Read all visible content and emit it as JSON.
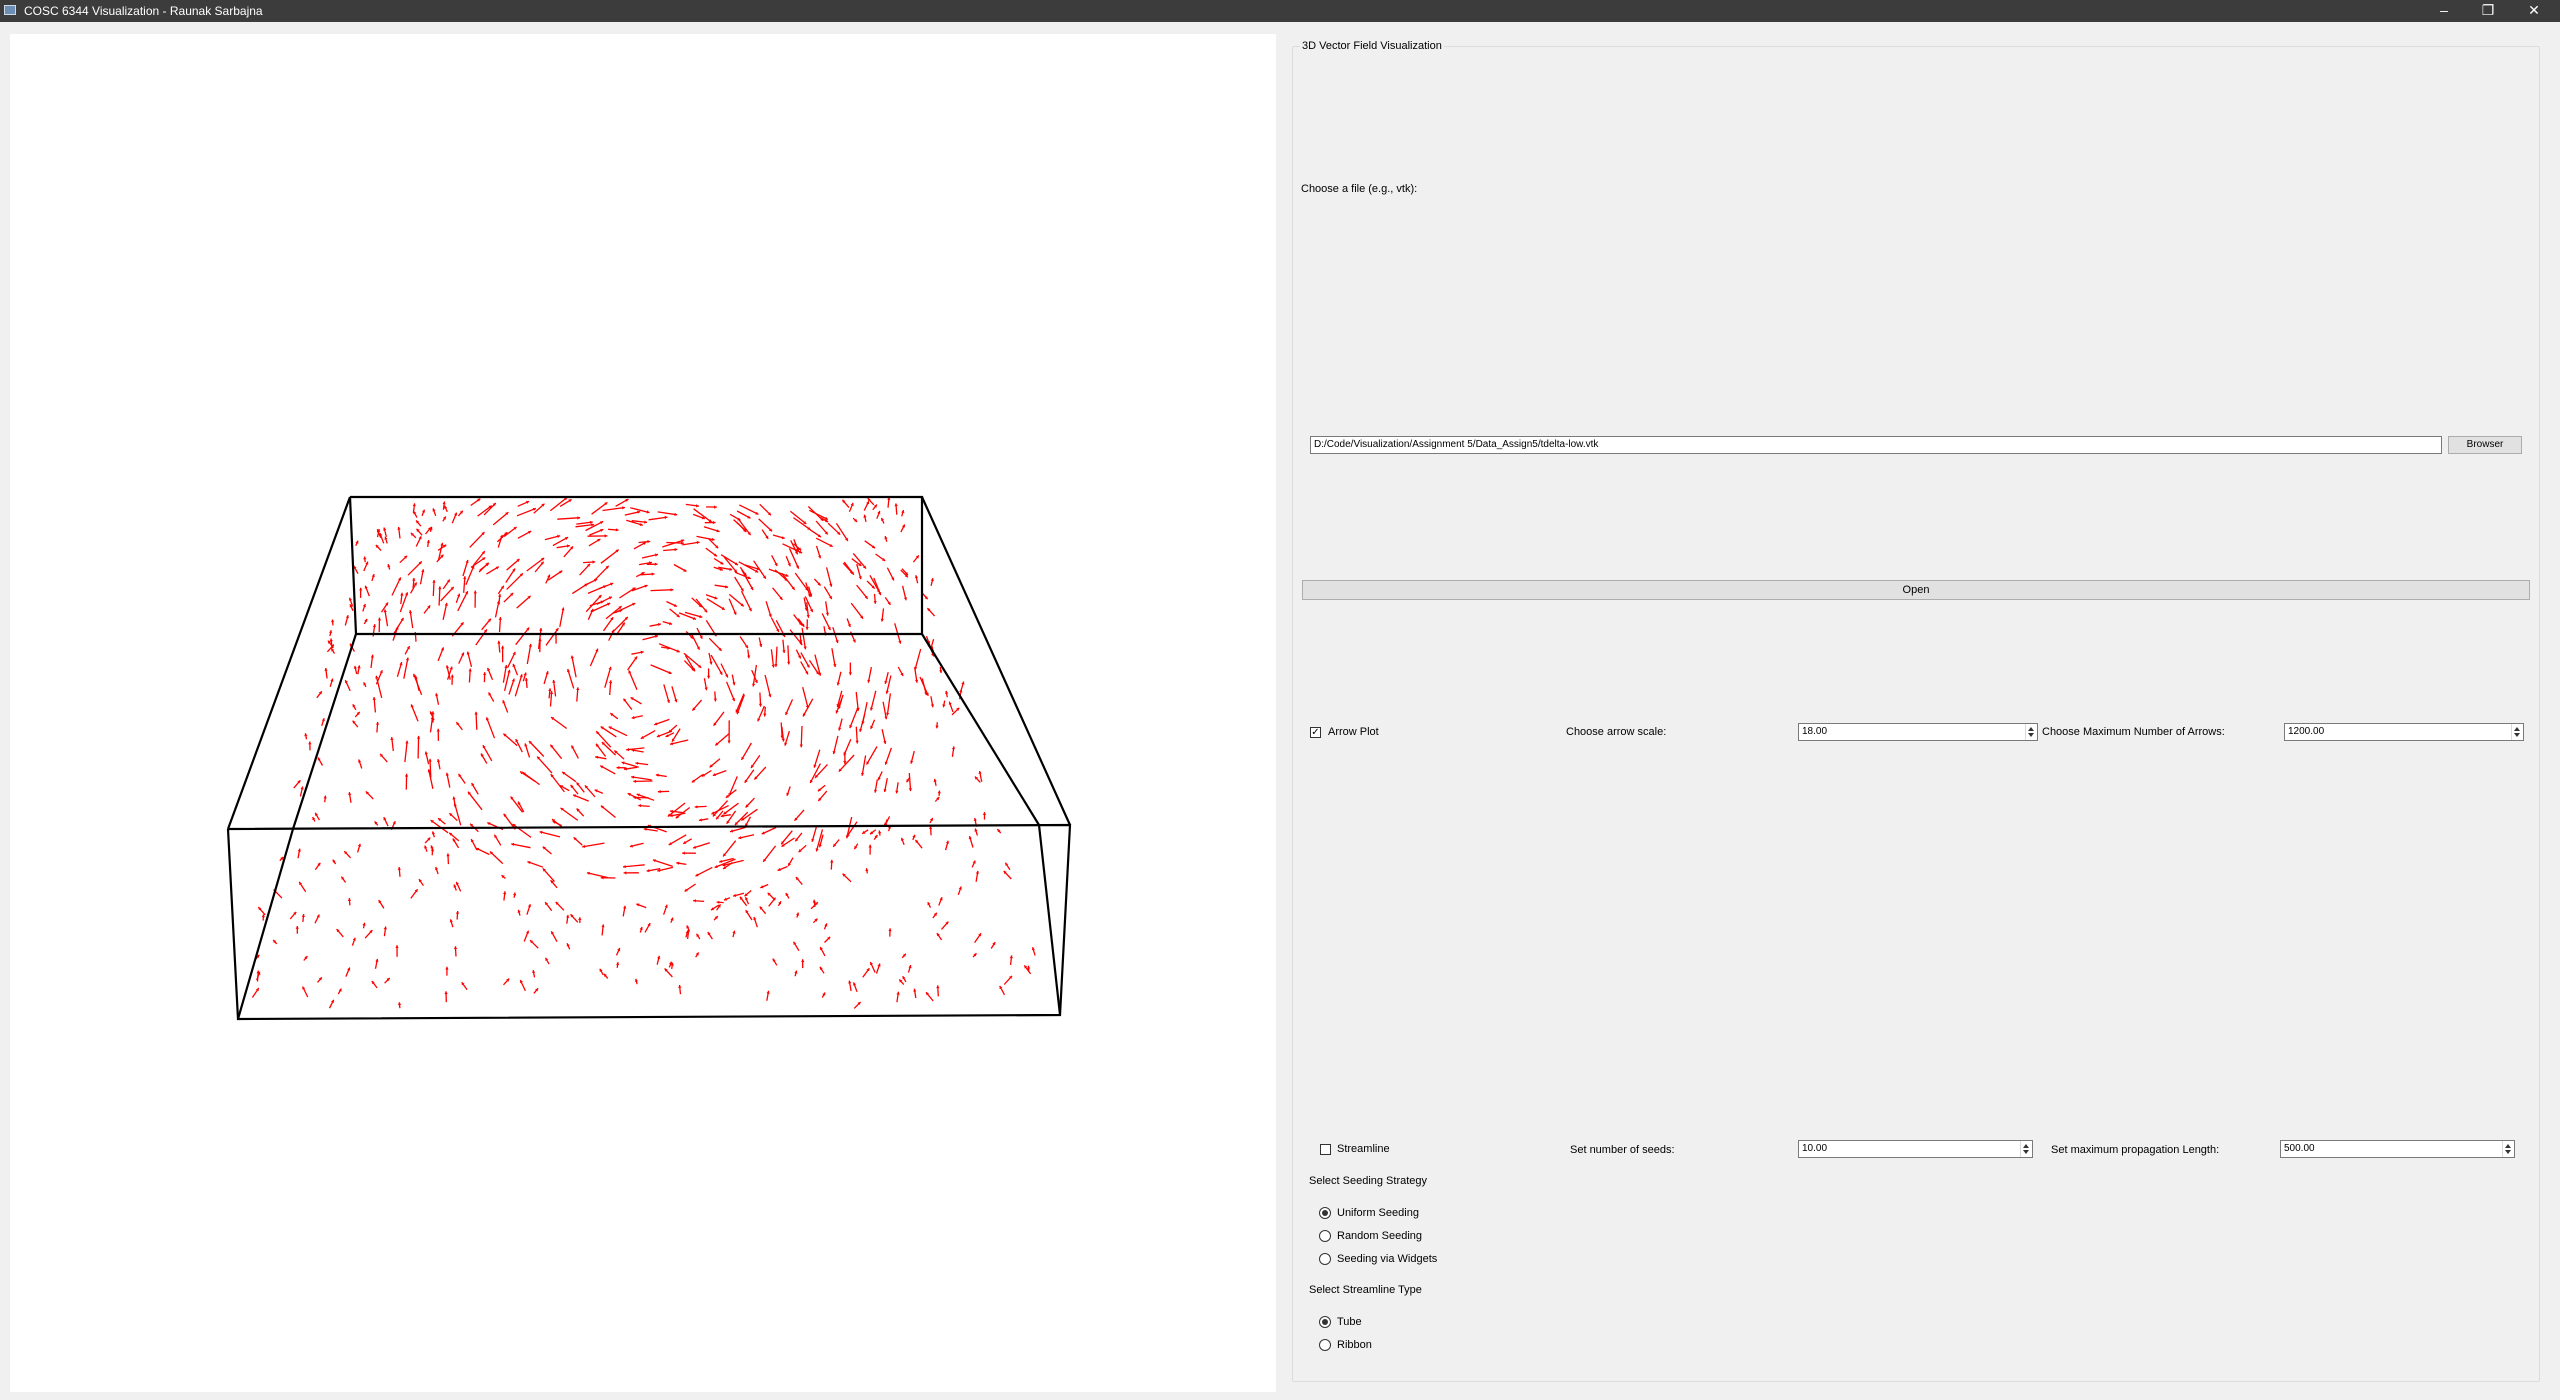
{
  "window": {
    "title": "COSC 6344 Visualization - Raunak Sarbajna",
    "minimize_glyph": "–",
    "restore_glyph": "❐",
    "close_glyph": "✕",
    "icon": "app-window-icon"
  },
  "viewport": {
    "background": "#ffffff",
    "box_color": "#000000",
    "arrow_color": "#ff0000"
  },
  "panel": {
    "group_title": "3D Vector Field Visualization",
    "file_label": "Choose a file (e.g., vtk):",
    "file_path": "D:/Code/Visualization/Assignment 5/Data_Assign5/tdelta-low.vtk",
    "browse_button": "Browser",
    "open_button": "Open",
    "arrow_plot": {
      "checkbox_label": "Arrow Plot",
      "checked": true,
      "scale_label": "Choose arrow scale:",
      "scale_value": "18.00",
      "max_label": "Choose Maximum Number of Arrows:",
      "max_value": "1200.00"
    },
    "streamline": {
      "checkbox_label": "Streamline",
      "checked": false,
      "seeds_label": "Set number of seeds:",
      "seeds_value": "10.00",
      "length_label": "Set maximum propagation Length:",
      "length_value": "500.00"
    },
    "seeding": {
      "title": "Select Seeding Strategy",
      "options": [
        "Uniform Seeding",
        "Random Seeding",
        "Seeding via Widgets"
      ],
      "selected": "Uniform Seeding"
    },
    "streamline_type": {
      "title": "Select Streamline Type",
      "options": [
        "Tube",
        "Ribbon"
      ],
      "selected": "Tube"
    }
  }
}
